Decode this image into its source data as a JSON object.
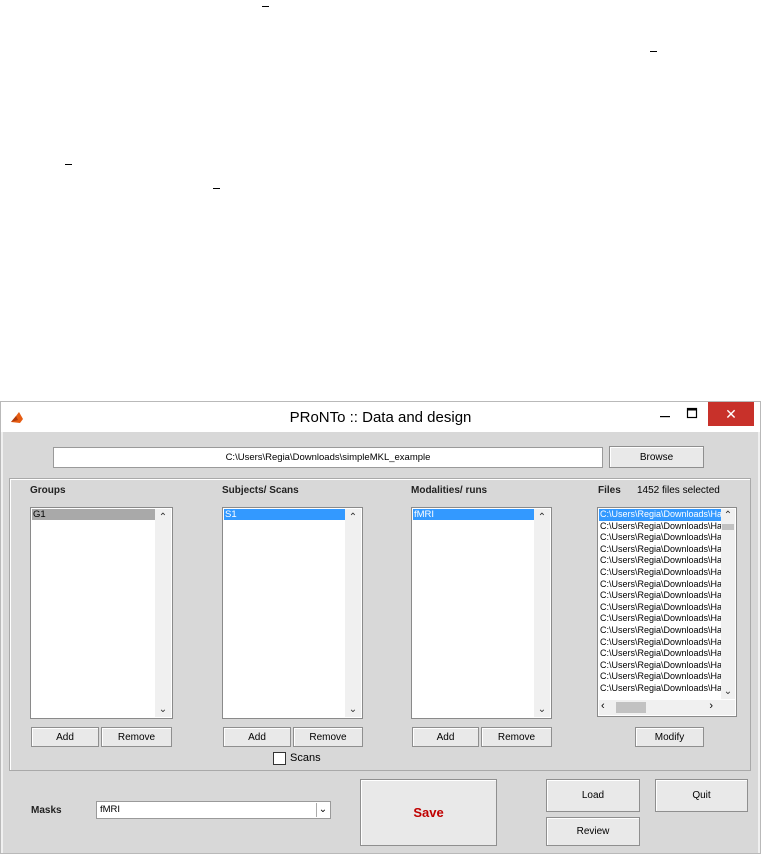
{
  "window": {
    "title": "PRoNTo :: Data and design",
    "close_glyph": "✕",
    "close_color": "#c8312a"
  },
  "dir_path": "C:\\Users\\Regia\\Downloads\\simpleMKL_example",
  "buttons": {
    "browse": "Browse",
    "add": "Add",
    "remove": "Remove",
    "modify": "Modify",
    "save": "Save",
    "load": "Load",
    "quit": "Quit",
    "review": "Review"
  },
  "groups": {
    "label": "Groups",
    "items": [
      "G1"
    ]
  },
  "subjects": {
    "label": "Subjects/ Scans",
    "items": [
      "S1"
    ]
  },
  "modalities": {
    "label": "Modalities/ runs",
    "items": [
      "fMRI"
    ]
  },
  "files": {
    "label": "Files",
    "count_text": "1452 files selected",
    "row_text": "C:\\Users\\Regia\\Downloads\\Ha",
    "visible_rows": 16
  },
  "scans_checkbox": {
    "label": "Scans",
    "checked": false
  },
  "masks": {
    "label": "Masks",
    "selected": "fMRI"
  },
  "colors": {
    "selected_row": "#3399ff",
    "inactive_selection": "#a9a9a9",
    "save_text": "#c00000"
  }
}
